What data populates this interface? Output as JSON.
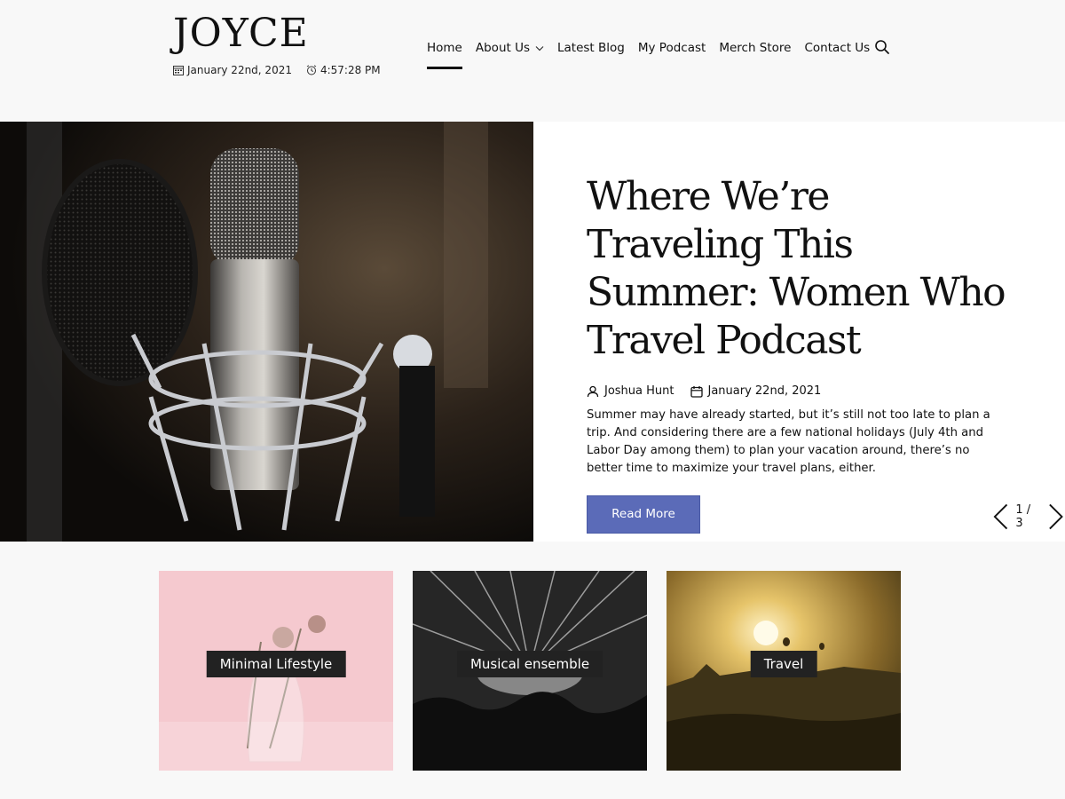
{
  "site": {
    "logo": "JOYCE",
    "date": "January 22nd, 2021",
    "time": "4:57:28 PM"
  },
  "nav": {
    "home": "Home",
    "about": "About Us",
    "blog": "Latest Blog",
    "podcast": "My Podcast",
    "merch": "Merch Store",
    "contact": "Contact Us"
  },
  "hero": {
    "title": "Where We’re Traveling This Summer: Women Who Travel Podcast",
    "author": "Joshua Hunt",
    "date": "January 22nd, 2021",
    "excerpt": "Summer may have already started, but it’s still not too late to plan a trip. And considering there are a few national holidays (July 4th and Labor Day among them) to plan your vacation around, there’s no better time to maximize your travel plans, either.",
    "read_more": "Read More",
    "pager": "1 / 3",
    "button_color": "#5b6bb8"
  },
  "cards": [
    {
      "label": "Minimal Lifestyle"
    },
    {
      "label": "Musical ensemble"
    },
    {
      "label": "Travel"
    }
  ],
  "icons": [
    "calendar-icon",
    "clock-icon",
    "chevron-down-icon",
    "search-icon",
    "user-icon",
    "arrow-left-icon",
    "arrow-right-icon"
  ]
}
